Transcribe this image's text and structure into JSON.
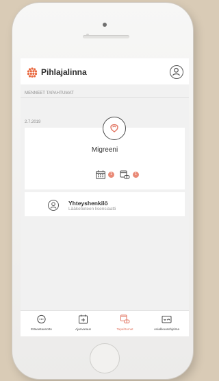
{
  "app": {
    "brand": "Pihlajalinna"
  },
  "section": {
    "title": "MENNEET TAPAHTUMAT"
  },
  "event": {
    "date": "2.7.2019",
    "title": "Migreeni",
    "calendar_count": "1",
    "medication_count": "1"
  },
  "contact": {
    "name": "Yhteyshenkilö",
    "role": "Lääketieteen lisensiaatti"
  },
  "tabs": [
    {
      "label": "Etävastaanotto",
      "icon": "chat-icon"
    },
    {
      "label": "Ajanvaraus",
      "icon": "calendar-plus-icon"
    },
    {
      "label": "Tapahtumat",
      "icon": "events-icon",
      "active": true
    },
    {
      "label": "Asiakkuusohjelma",
      "icon": "membership-card-icon"
    }
  ],
  "colors": {
    "accent": "#e27663",
    "brand_orange": "#e9683f",
    "badge": "#e98a77"
  }
}
